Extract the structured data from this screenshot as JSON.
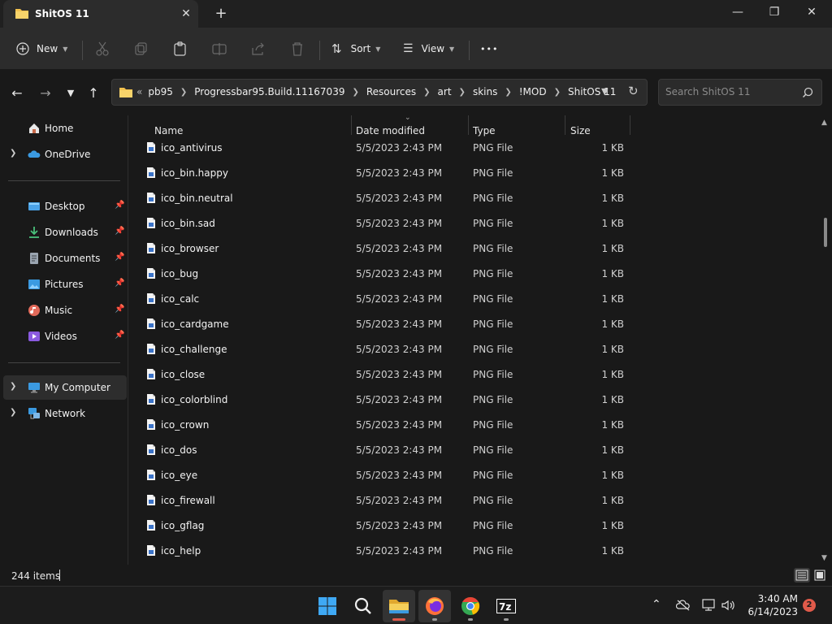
{
  "window": {
    "tab_title": "ShitOS 11",
    "tab_close": "✕",
    "new_tab": "+",
    "minimize": "—",
    "maximize": "❐",
    "close": "✕"
  },
  "toolbar": {
    "new_label": "New",
    "sort_label": "Sort",
    "view_label": "View",
    "more_label": "•••"
  },
  "address": {
    "crumbs": [
      "«",
      "pb95",
      "Progressbar95.Build.11167039",
      "Resources",
      "art",
      "skins",
      "!MOD",
      "ShitOS 11"
    ],
    "search_placeholder": "Search ShitOS 11"
  },
  "sidebar": {
    "items": [
      {
        "label": "Home",
        "icon": "home-icon"
      },
      {
        "label": "OneDrive",
        "icon": "cloud-icon"
      },
      {
        "label": "Desktop",
        "icon": "desktop-icon"
      },
      {
        "label": "Downloads",
        "icon": "download-icon"
      },
      {
        "label": "Documents",
        "icon": "document-icon"
      },
      {
        "label": "Pictures",
        "icon": "pictures-icon"
      },
      {
        "label": "Music",
        "icon": "music-icon"
      },
      {
        "label": "Videos",
        "icon": "video-icon"
      },
      {
        "label": "My Computer",
        "icon": "computer-icon"
      },
      {
        "label": "Network",
        "icon": "network-icon"
      }
    ]
  },
  "list": {
    "columns": [
      "Name",
      "Date modified",
      "Type",
      "Size"
    ],
    "rows": [
      {
        "name": "ico_antivirus",
        "date": "5/5/2023 2:43 PM",
        "type": "PNG File",
        "size": "1 KB"
      },
      {
        "name": "ico_bin.happy",
        "date": "5/5/2023 2:43 PM",
        "type": "PNG File",
        "size": "1 KB"
      },
      {
        "name": "ico_bin.neutral",
        "date": "5/5/2023 2:43 PM",
        "type": "PNG File",
        "size": "1 KB"
      },
      {
        "name": "ico_bin.sad",
        "date": "5/5/2023 2:43 PM",
        "type": "PNG File",
        "size": "1 KB"
      },
      {
        "name": "ico_browser",
        "date": "5/5/2023 2:43 PM",
        "type": "PNG File",
        "size": "1 KB"
      },
      {
        "name": "ico_bug",
        "date": "5/5/2023 2:43 PM",
        "type": "PNG File",
        "size": "1 KB"
      },
      {
        "name": "ico_calc",
        "date": "5/5/2023 2:43 PM",
        "type": "PNG File",
        "size": "1 KB"
      },
      {
        "name": "ico_cardgame",
        "date": "5/5/2023 2:43 PM",
        "type": "PNG File",
        "size": "1 KB"
      },
      {
        "name": "ico_challenge",
        "date": "5/5/2023 2:43 PM",
        "type": "PNG File",
        "size": "1 KB"
      },
      {
        "name": "ico_close",
        "date": "5/5/2023 2:43 PM",
        "type": "PNG File",
        "size": "1 KB"
      },
      {
        "name": "ico_colorblind",
        "date": "5/5/2023 2:43 PM",
        "type": "PNG File",
        "size": "1 KB"
      },
      {
        "name": "ico_crown",
        "date": "5/5/2023 2:43 PM",
        "type": "PNG File",
        "size": "1 KB"
      },
      {
        "name": "ico_dos",
        "date": "5/5/2023 2:43 PM",
        "type": "PNG File",
        "size": "1 KB"
      },
      {
        "name": "ico_eye",
        "date": "5/5/2023 2:43 PM",
        "type": "PNG File",
        "size": "1 KB"
      },
      {
        "name": "ico_firewall",
        "date": "5/5/2023 2:43 PM",
        "type": "PNG File",
        "size": "1 KB"
      },
      {
        "name": "ico_gflag",
        "date": "5/5/2023 2:43 PM",
        "type": "PNG File",
        "size": "1 KB"
      },
      {
        "name": "ico_help",
        "date": "5/5/2023 2:43 PM",
        "type": "PNG File",
        "size": "1 KB"
      }
    ]
  },
  "status": {
    "item_count": "244 items"
  },
  "taskbar": {
    "time": "3:40 AM",
    "date": "6/14/2023",
    "notifications": "2",
    "apps": [
      "start-icon",
      "search-icon",
      "file-explorer-icon",
      "firefox-icon",
      "chrome-icon",
      "7zip-icon"
    ]
  },
  "colors": {
    "background": "#191919",
    "titlebar": "#202020",
    "toolbar": "#2c2c2c",
    "folder": "#f2c14e",
    "accent": "#4aa3e8"
  }
}
